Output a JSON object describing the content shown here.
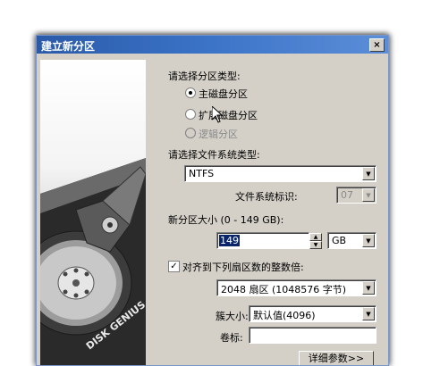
{
  "window": {
    "title": "建立新分区",
    "close_label": "×"
  },
  "partition_type": {
    "label": "请选择分区类型:",
    "options": [
      {
        "label": "主磁盘分区",
        "checked": true,
        "disabled": false
      },
      {
        "label": "扩展磁盘分区",
        "checked": false,
        "disabled": false
      },
      {
        "label": "逻辑分区",
        "checked": false,
        "disabled": true
      }
    ]
  },
  "filesystem": {
    "label": "请选择文件系统类型:",
    "value": "NTFS",
    "id_label": "文件系统标识:",
    "id_value": "07"
  },
  "size": {
    "label": "新分区大小 (0 - 149 GB):",
    "value": "149",
    "unit": "GB"
  },
  "align": {
    "label": "对齐到下列扇区数的整数倍:",
    "checked": true,
    "value": "2048 扇区 (1048576 字节)"
  },
  "cluster": {
    "label": "簇大小:",
    "value": "默认值(4096)"
  },
  "volume": {
    "label": "卷标:",
    "value": ""
  },
  "advanced_button": "详细参数>>",
  "art": {
    "brand_text": "DISK GENIUS"
  }
}
